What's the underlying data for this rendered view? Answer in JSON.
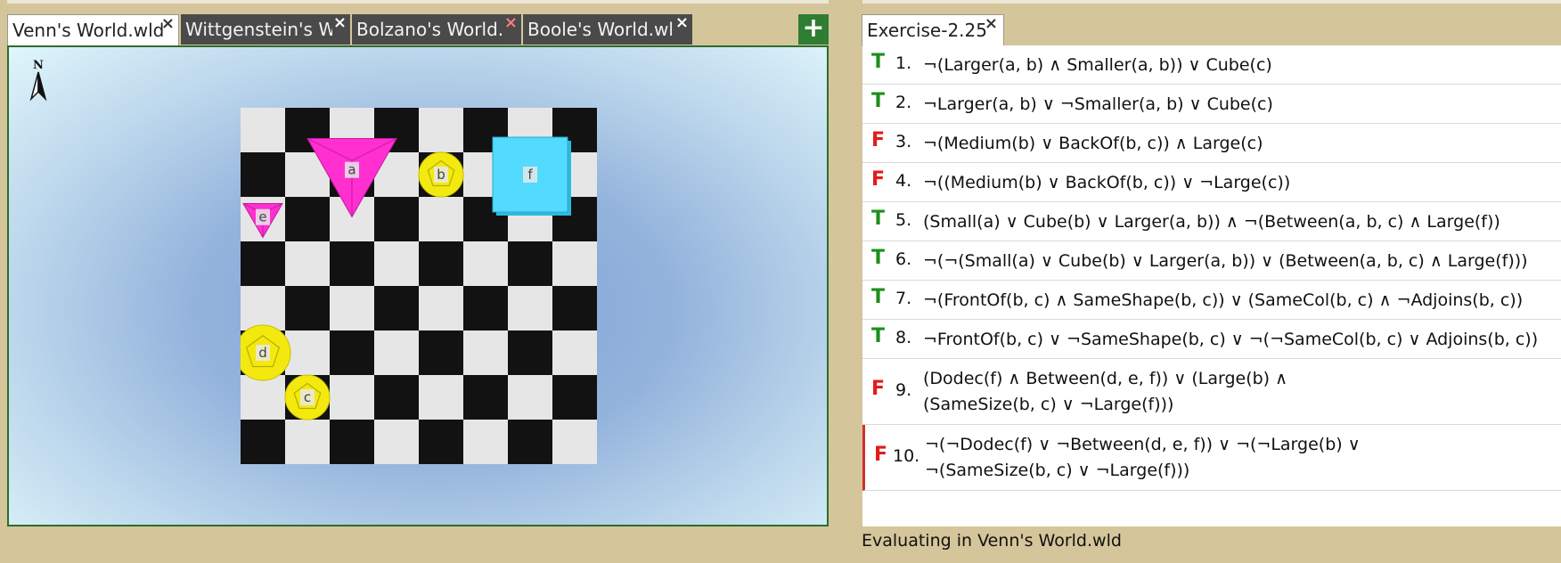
{
  "world_tabs": [
    {
      "label": "Venn's World.wld",
      "close": "×",
      "active": true
    },
    {
      "label": "Wittgenstein's World.wld",
      "close": "×",
      "active": false
    },
    {
      "label": "Bolzano's World.wld",
      "close": "×",
      "active": false
    },
    {
      "label": "Boole's World.wld",
      "close": "×",
      "active": false
    }
  ],
  "add_tab_label": "+",
  "compass_label": "N",
  "board": {
    "size": 8,
    "light_color": "#e6e6e6",
    "dark_color": "#121212",
    "objects": [
      {
        "name": "a",
        "shape": "tet",
        "size": "large",
        "color": "#ff2fd0",
        "col": 2,
        "row": 1
      },
      {
        "name": "b",
        "shape": "dodec",
        "size": "small",
        "color": "#f3e90e",
        "col": 4,
        "row": 1
      },
      {
        "name": "f",
        "shape": "cube",
        "size": "large",
        "color": "#52dbff",
        "col": 6,
        "row": 1
      },
      {
        "name": "e",
        "shape": "tet",
        "size": "small",
        "color": "#ff2fd0",
        "col": 0,
        "row": 2
      },
      {
        "name": "d",
        "shape": "dodec",
        "size": "large",
        "color": "#f3e90e",
        "col": 0,
        "row": 5
      },
      {
        "name": "c",
        "shape": "dodec",
        "size": "small",
        "color": "#f3e90e",
        "col": 1,
        "row": 6
      }
    ]
  },
  "sentence_tab": {
    "label": "Exercise-2.25",
    "close": "×"
  },
  "sentences": [
    {
      "value": "T",
      "num": "1.",
      "lines": [
        "¬(Larger(a, b) ∧ Smaller(a, b)) ∨ Cube(c)"
      ]
    },
    {
      "value": "T",
      "num": "2.",
      "lines": [
        "¬Larger(a, b) ∨ ¬Smaller(a, b) ∨ Cube(c)"
      ]
    },
    {
      "value": "F",
      "num": "3.",
      "lines": [
        "¬(Medium(b) ∨ BackOf(b, c)) ∧ Large(c)"
      ]
    },
    {
      "value": "F",
      "num": "4.",
      "lines": [
        "¬((Medium(b) ∨ BackOf(b, c)) ∨ ¬Large(c))"
      ]
    },
    {
      "value": "T",
      "num": "5.",
      "lines": [
        "(Small(a) ∨ Cube(b) ∨ Larger(a, b)) ∧ ¬(Between(a, b, c) ∧ Large(f))"
      ]
    },
    {
      "value": "T",
      "num": "6.",
      "lines": [
        "¬(¬(Small(a) ∨ Cube(b) ∨ Larger(a, b)) ∨ (Between(a, b, c) ∧ Large(f)))"
      ]
    },
    {
      "value": "T",
      "num": "7.",
      "lines": [
        "¬(FrontOf(b, c) ∧ SameShape(b, c)) ∨ (SameCol(b, c) ∧ ¬Adjoins(b, c))"
      ]
    },
    {
      "value": "T",
      "num": "8.",
      "lines": [
        "¬FrontOf(b, c) ∨ ¬SameShape(b, c) ∨ ¬(¬SameCol(b, c) ∨ Adjoins(b, c))"
      ]
    },
    {
      "value": "F",
      "num": "9.",
      "lines": [
        "(Dodec(f) ∧ Between(d, e, f)) ∨ (Large(b) ∧",
        "(SameSize(b, c) ∨ ¬Large(f)))"
      ]
    },
    {
      "value": "F",
      "num": "10.",
      "lines": [
        "¬(¬Dodec(f) ∨ ¬Between(d, e, f)) ∨ ¬(¬Large(b) ∨",
        "¬(SameSize(b, c) ∨ ¬Large(f)))"
      ],
      "selected": true
    }
  ],
  "status": "Evaluating in Venn's World.wld"
}
